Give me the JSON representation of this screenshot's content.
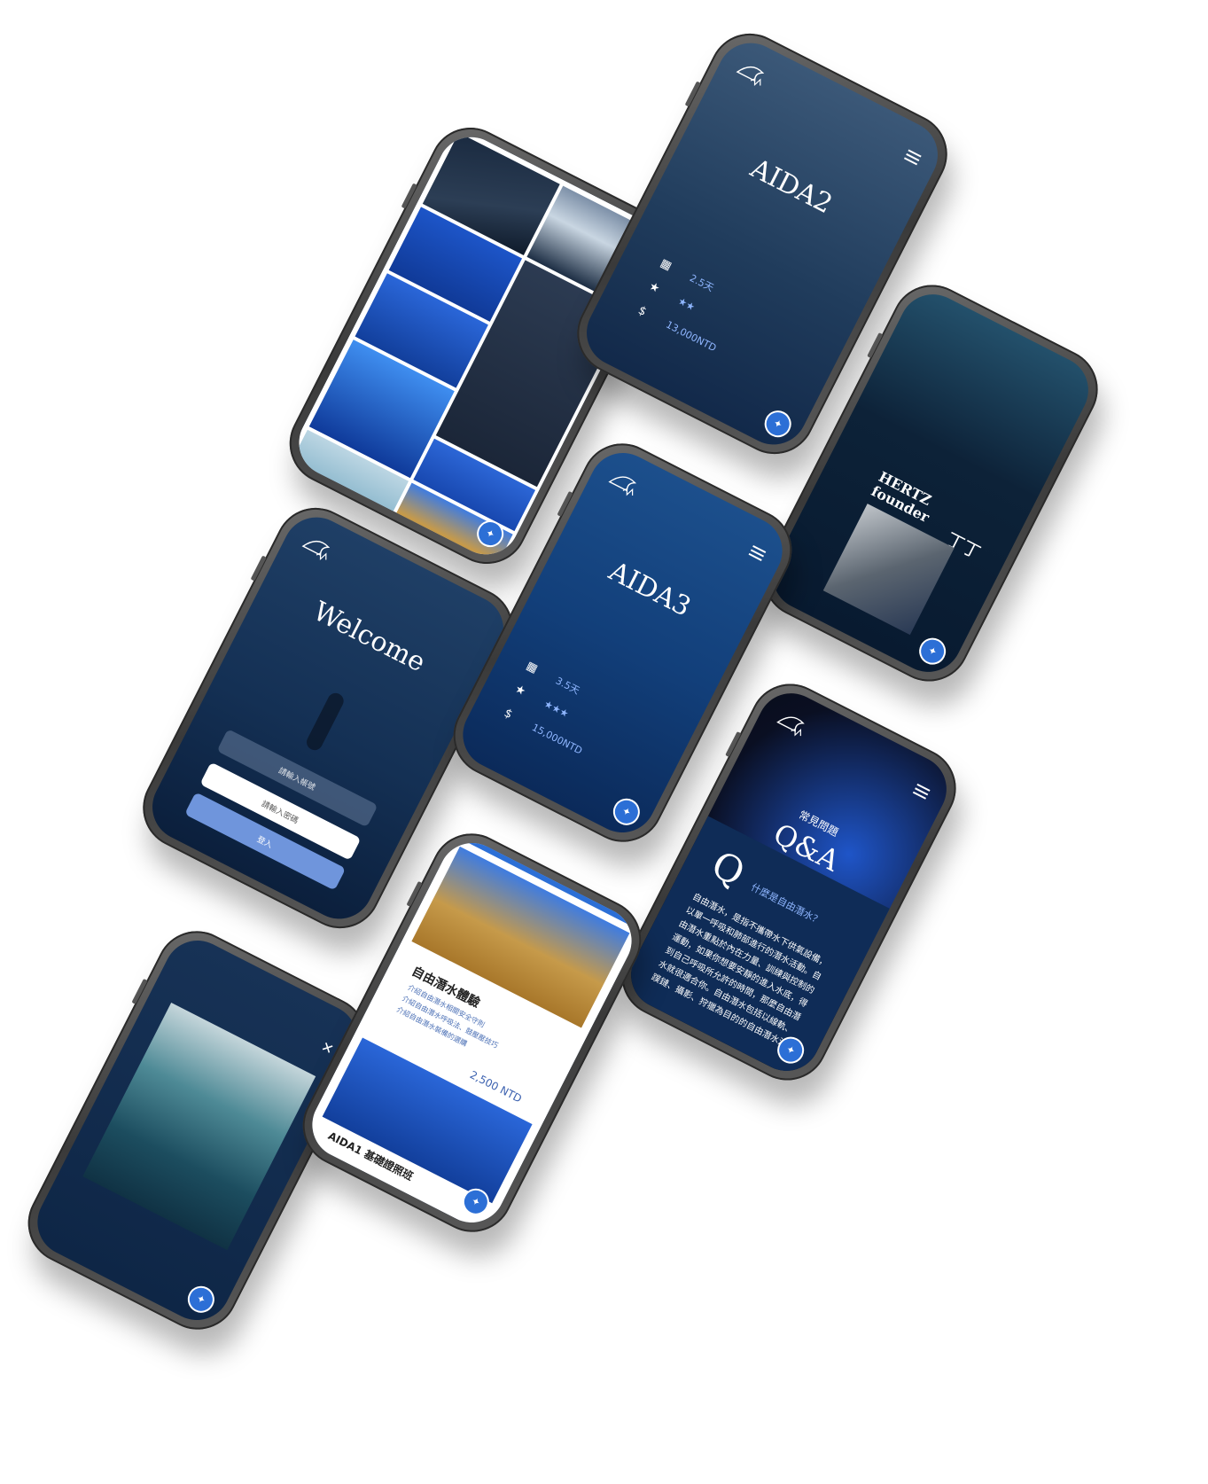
{
  "gallery_phone": {},
  "aida2": {
    "title": "AIDA2",
    "info": {
      "duration_value": "2.5天",
      "stars": "★★",
      "price_value": "13,000NTD"
    }
  },
  "founder": {
    "name_line1": "HERTZ",
    "name_line2": "founder",
    "signature": "丁丁"
  },
  "welcome": {
    "title": "Welcome",
    "password_placeholder": "請輸入帳號",
    "account_placeholder": "請輸入密碼",
    "login_label": "登入"
  },
  "aida3": {
    "title": "AIDA3",
    "info": {
      "duration_value": "3.5天",
      "stars": "★★★",
      "price_value": "15,000NTD"
    }
  },
  "qa": {
    "heading_small": "常見問題",
    "heading": "Q&A",
    "q_letter": "Q",
    "question": "什麼是自由潛水？",
    "answer": "自由潛水，是指不攜帶水下供氣設備，以單一呼吸和肺部進行的潛水活動。自由潛水重點於內在力量、訓練與控制的運動，如果你想要安靜的進入水底，得到自己呼吸所允許的時間，那麼自由潛水就很適合你。自由潛水包括以線軌、蹼鏈、攝影、狩獵為目的的自由潛水活動，和競賽性質的極限競技項目，目前有關自由潛水的世界紀錄是水下二一四米，是Alexey Molchanov所下的紀錄。"
  },
  "course": {
    "course1_title": "自由潛水體驗",
    "course1_lines": [
      "介紹自由潛水相關安全守則",
      "介紹自由潛水呼吸法、鼓壓壓技巧",
      "介紹自由潛水裝備的選購"
    ],
    "course1_price": "2,500 NTD",
    "course2_title": "AIDA1 基礎證照班"
  },
  "colors": {
    "deep_blue": "#0c2444",
    "accent_blue": "#8fb6ff",
    "button_blue": "#6f95dc",
    "messenger_blue": "#2c6fd6"
  }
}
